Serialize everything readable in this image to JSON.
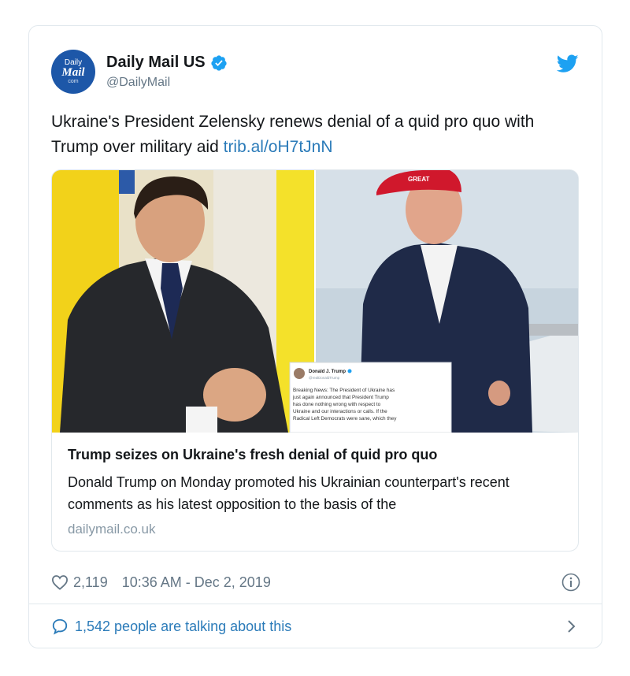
{
  "account": {
    "name": "Daily Mail US",
    "handle": "@DailyMail",
    "avatar_text": [
      "Daily",
      "Mail",
      "com"
    ]
  },
  "tweet": {
    "text": "Ukraine's President Zelensky renews denial of a quid pro quo with Trump over military aid ",
    "link": "trib.al/oH7tJnN"
  },
  "card": {
    "title": "Trump seizes on Ukraine's fresh denial of quid pro quo",
    "description": "Donald Trump on Monday promoted his Ukrainian counterpart's recent comments as his latest opposition to the basis of the",
    "domain": "dailymail.co.uk",
    "hat_text": "GREAT",
    "embedded_tweet": {
      "name": "Donald J. Trump",
      "handle": "@realDonaldTrump",
      "lines": [
        "Breaking News: The President of Ukraine has",
        "just again announced that President Trump",
        "has done nothing wrong with respect to",
        "Ukraine and our interactions or calls. If the",
        "Radical Left Democrats were sane, which they"
      ]
    }
  },
  "meta": {
    "likes": "2,119",
    "timestamp": "10:36 AM - Dec 2, 2019"
  },
  "footer": {
    "talking": "1,542 people are talking about this"
  },
  "colors": {
    "link": "#2b7bb9",
    "verified": "#1da1f2",
    "twitter": "#1da1f2",
    "secondary": "#657786",
    "border": "#e1e8ed"
  }
}
